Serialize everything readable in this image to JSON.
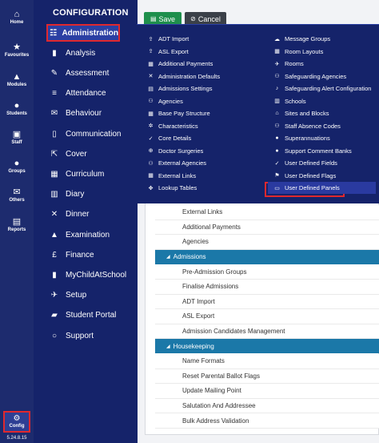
{
  "rail": {
    "items": [
      {
        "label": "Home",
        "icon": "home-icon",
        "glyph": "⌂"
      },
      {
        "label": "Favourites",
        "icon": "star-icon",
        "glyph": "★"
      },
      {
        "label": "Modules",
        "icon": "modules-icon",
        "glyph": "▲"
      },
      {
        "label": "Students",
        "icon": "students-icon",
        "glyph": "●"
      },
      {
        "label": "Staff",
        "icon": "staff-icon",
        "glyph": "▣"
      },
      {
        "label": "Groups",
        "icon": "groups-icon",
        "glyph": "●"
      },
      {
        "label": "Others",
        "icon": "others-icon",
        "glyph": "✉"
      },
      {
        "label": "Reports",
        "icon": "reports-icon",
        "glyph": "▤"
      }
    ],
    "config": {
      "label": "Config",
      "glyph": "⚙"
    },
    "version": "5.24.8.15"
  },
  "config": {
    "title": "CONFIGURATION",
    "items": [
      {
        "label": "Administration",
        "glyph": "☷",
        "icon": "administration-icon"
      },
      {
        "label": "Analysis",
        "glyph": "▮",
        "icon": "analysis-icon"
      },
      {
        "label": "Assessment",
        "glyph": "✎",
        "icon": "assessment-icon"
      },
      {
        "label": "Attendance",
        "glyph": "≡",
        "icon": "attendance-icon"
      },
      {
        "label": "Behaviour",
        "glyph": "✉",
        "icon": "behaviour-icon"
      },
      {
        "label": "Communication",
        "glyph": "▯",
        "icon": "communication-icon"
      },
      {
        "label": "Cover",
        "glyph": "⇱",
        "icon": "cover-icon"
      },
      {
        "label": "Curriculum",
        "glyph": "▦",
        "icon": "curriculum-icon"
      },
      {
        "label": "Diary",
        "glyph": "▥",
        "icon": "diary-icon"
      },
      {
        "label": "Dinner",
        "glyph": "✕",
        "icon": "dinner-icon"
      },
      {
        "label": "Examination",
        "glyph": "▲",
        "icon": "examination-icon"
      },
      {
        "label": "Finance",
        "glyph": "£",
        "icon": "finance-icon"
      },
      {
        "label": "MyChildAtSchool",
        "glyph": "▮",
        "icon": "mychildatschool-icon"
      },
      {
        "label": "Setup",
        "glyph": "✈",
        "icon": "setup-icon"
      },
      {
        "label": "Student Portal",
        "glyph": "▰",
        "icon": "student-portal-icon"
      },
      {
        "label": "Support",
        "glyph": "○",
        "icon": "support-icon"
      }
    ]
  },
  "toolbar": {
    "save_label": "Save",
    "save_glyph": "▤",
    "cancel_label": "Cancel",
    "cancel_glyph": "⊘"
  },
  "menu": {
    "left": [
      {
        "label": "ADT Import",
        "glyph": "⇪"
      },
      {
        "label": "ASL Export",
        "glyph": "⇪"
      },
      {
        "label": "Additional Payments",
        "glyph": "▦"
      },
      {
        "label": "Administration Defaults",
        "glyph": "✕"
      },
      {
        "label": "Admissions Settings",
        "glyph": "▤"
      },
      {
        "label": "Agencies",
        "glyph": "⚇"
      },
      {
        "label": "Base Pay Structure",
        "glyph": "▦"
      },
      {
        "label": "Characteristics",
        "glyph": "✲"
      },
      {
        "label": "Core Details",
        "glyph": "✓"
      },
      {
        "label": "Doctor Surgeries",
        "glyph": "⊕"
      },
      {
        "label": "External Agencies",
        "glyph": "⚇"
      },
      {
        "label": "External Links",
        "glyph": "▦"
      },
      {
        "label": "Lookup Tables",
        "glyph": "✥"
      }
    ],
    "right": [
      {
        "label": "Message Groups",
        "glyph": "☁"
      },
      {
        "label": "Room Layouts",
        "glyph": "▦"
      },
      {
        "label": "Rooms",
        "glyph": "✈"
      },
      {
        "label": "Safeguarding Agencies",
        "glyph": "⚇"
      },
      {
        "label": "Safeguarding Alert Configuration",
        "glyph": "♪"
      },
      {
        "label": "Schools",
        "glyph": "▥"
      },
      {
        "label": "Sites and Blocks",
        "glyph": "⌂"
      },
      {
        "label": "Staff Absence Codes",
        "glyph": "⚇"
      },
      {
        "label": "Superannuations",
        "glyph": "●"
      },
      {
        "label": "Support Comment Banks",
        "glyph": "●"
      },
      {
        "label": "User Defined Fields",
        "glyph": "✓"
      },
      {
        "label": "User Defined Flags",
        "glyph": "⚑"
      },
      {
        "label": "User Defined Panels",
        "glyph": "▭"
      }
    ]
  },
  "list": [
    {
      "type": "row",
      "label": "External Links"
    },
    {
      "type": "row",
      "label": "Additional Payments"
    },
    {
      "type": "row",
      "label": "Agencies"
    },
    {
      "type": "section",
      "label": "Admissions"
    },
    {
      "type": "row",
      "label": "Pre-Admission Groups"
    },
    {
      "type": "row",
      "label": "Finalise Admissions"
    },
    {
      "type": "row",
      "label": "ADT Import"
    },
    {
      "type": "row",
      "label": "ASL Export"
    },
    {
      "type": "row",
      "label": "Admission Candidates Management"
    },
    {
      "type": "section",
      "label": "Housekeeping"
    },
    {
      "type": "row",
      "label": "Name Formats"
    },
    {
      "type": "row",
      "label": "Reset Parental Ballot Flags"
    },
    {
      "type": "row",
      "label": "Update Mailing Point"
    },
    {
      "type": "row",
      "label": "Salutation And Addressee"
    },
    {
      "type": "row",
      "label": "Bulk Address Validation"
    }
  ]
}
